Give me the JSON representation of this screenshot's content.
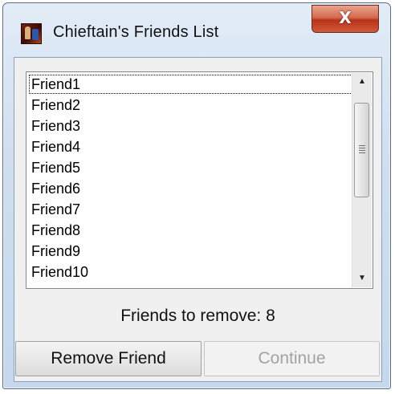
{
  "window": {
    "title": "Chieftain's Friends List",
    "close_label": "X"
  },
  "list": {
    "items": [
      "Friend1",
      "Friend2",
      "Friend3",
      "Friend4",
      "Friend5",
      "Friend6",
      "Friend7",
      "Friend8",
      "Friend9",
      "Friend10"
    ],
    "focused_index": 0
  },
  "scrollbar": {
    "up_icon": "▲",
    "down_icon": "▼"
  },
  "status": {
    "text": "Friends to remove: 8"
  },
  "buttons": {
    "remove_label": "Remove Friend",
    "continue_label": "Continue",
    "continue_enabled": false
  },
  "colors": {
    "title_bar": "#cfdff0",
    "close_button": "#c8462b",
    "disabled_text": "#a3a3a3"
  }
}
